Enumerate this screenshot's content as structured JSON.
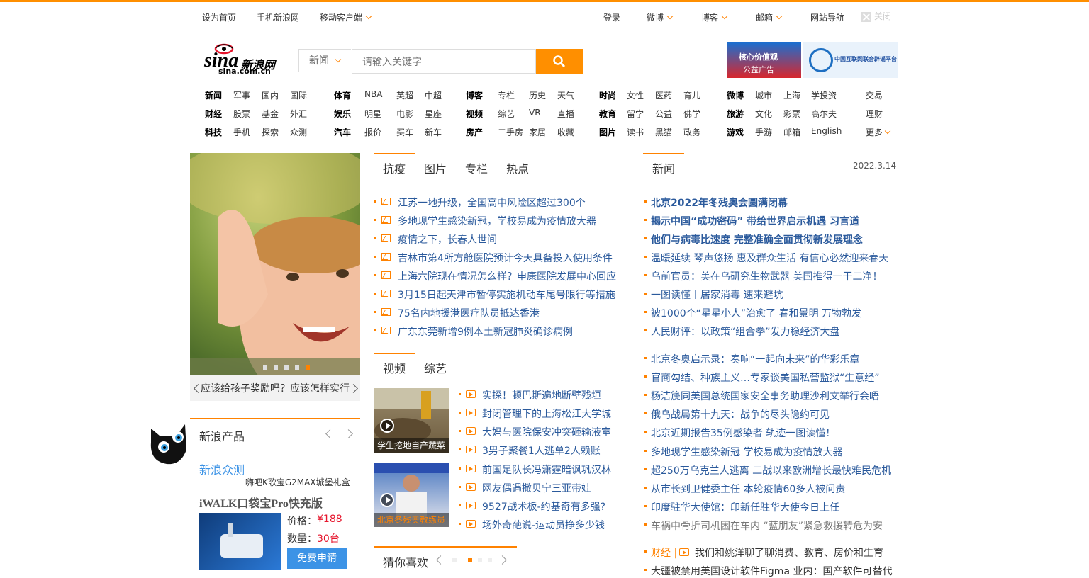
{
  "topbar": {
    "set_home": "设为首页",
    "mobile_news": "手机新浪网",
    "mobile_client": "移动客户端",
    "login": "登录",
    "weibo": "微博",
    "blog": "博客",
    "mail": "邮箱",
    "site_nav": "网站导航",
    "close": "关闭"
  },
  "logo": {
    "brand": "sina",
    "cn": "新浪网",
    "url_text": "sina.com.cn"
  },
  "search": {
    "category": "新闻",
    "placeholder": "请输入关键字"
  },
  "nav": {
    "col1": [
      [
        "新闻",
        "军事",
        "国内",
        "国际"
      ],
      [
        "财经",
        "股票",
        "基金",
        "外汇"
      ],
      [
        "科技",
        "手机",
        "探索",
        "众测"
      ]
    ],
    "col2": [
      [
        "体育",
        "NBA",
        "英超",
        "中超"
      ],
      [
        "娱乐",
        "明星",
        "电影",
        "星座"
      ],
      [
        "汽车",
        "报价",
        "买车",
        "新车"
      ]
    ],
    "col3": [
      [
        "博客",
        "专栏",
        "历史",
        "天气"
      ],
      [
        "视频",
        "综艺",
        "VR",
        "直播"
      ],
      [
        "房产",
        "二手房",
        "家居",
        "收藏"
      ]
    ],
    "col4": [
      [
        "时尚",
        "女性",
        "医药",
        "育儿"
      ],
      [
        "教育",
        "留学",
        "公益",
        "佛学"
      ],
      [
        "图片",
        "读书",
        "黑猫",
        "政务"
      ]
    ],
    "col5": [
      [
        "微博",
        "城市",
        "上海",
        "学投资"
      ],
      [
        "旅游",
        "文化",
        "彩票",
        "高尔夫"
      ],
      [
        "游戏",
        "手游",
        "邮箱",
        "English"
      ]
    ],
    "col6": [
      "交易",
      "理财",
      "更多"
    ]
  },
  "slide": {
    "caption": "应该给孩子奖励吗？应该怎样实行"
  },
  "products": {
    "title": "新浪产品",
    "subtitle": "新浪众测",
    "promo": "嗨吧K歌宝G2MAX城堡礼盒",
    "item_name": "iWALK口袋宝Pro快充版",
    "price_label": "价格：",
    "price": "¥188",
    "qty_label": "数量：",
    "qty": "30台",
    "apply": "免费申请"
  },
  "center": {
    "tabs": [
      "抗疫",
      "图片",
      "专栏",
      "热点"
    ],
    "news": [
      "江苏一地升级，全国高中风险区超过300个",
      "多地现学生感染新冠，学校易成为疫情放大器",
      "疫情之下，长春人世间",
      "吉林市第4所方舱医院预计今天具备投入使用条件",
      "上海六院现在情况怎么样？申康医院发展中心回应",
      "3月15日起天津市暂停实施机动车尾号限行等措施",
      "75名内地援港医疗队员抵达香港",
      "广东东莞新增9例本土新冠肺炎确诊病例"
    ],
    "video_tabs": [
      "视频",
      "综艺"
    ],
    "thumb1_caption": "学生挖地自产蔬菜",
    "thumb2_caption": "北京冬残奥教练员",
    "videos": [
      "实探！顿巴斯遍地断壁残垣",
      "封闭管理下的上海松江大学城",
      "大妈与医院保安冲突砸输液室",
      "3男子聚餐1人逃单2人赖账",
      "前国足队长冯潇霆暗讽巩汉林",
      "网友偶遇撒贝宁三亚带娃",
      "9527战术板-约基奇有多强?",
      "场外奇葩说-运动员挣多少钱"
    ],
    "guess": "猜你喜欢"
  },
  "right": {
    "tab": "新闻",
    "date": "2022.3.14",
    "headlines": [
      "北京2022年冬残奥会圆满闭幕",
      "揭示中国“成功密码” 带给世界启示机遇 习言道",
      "他们与病毒比速度 完整准确全面贯彻新发展理念"
    ],
    "news1": [
      "温暖延续 琴声悠扬 惠及群众生活 有信心必然迎来春天",
      "乌前官员：美在乌研究生物武器 美国推得一干二净！",
      "一图读懂丨居家消毒 速来避坑",
      "被1000个“星星小人”治愈了 春和景明 万物勃发",
      "人民财评：以政策“组合拳”发力稳经济大盘"
    ],
    "news2": [
      "北京冬奥启示录：奏响“一起向未来”的华彩乐章",
      "官商勾结、种族主义…专家谈美国私营监狱“生意经”",
      "杨洁篪同美国总统国家安全事务助理沙利文举行会晤",
      "俄乌战局第十九天：战争的尽头隐约可见",
      "北京近期报告35例感染者 轨迹一图读懂！",
      "多地现学生感染新冠 学校易成为疫情放大器",
      "超250万乌克兰人逃离 二战以来欧洲增长最快难民危机",
      "从市长到卫健委主任 本轮疫情60多人被问责",
      "印度驻华大使馆：印新任驻华大使今日上任",
      "车祸中骨折司机困在车内 “蓝朋友”紧急救援转危为安"
    ],
    "finance_label": "财经 |",
    "finance_news": "我们和姚洋聊了聊消费、教育、房价和生育",
    "last_news": "大疆被禁用美国设计软件Figma 业内：国产软件可替代"
  },
  "colors": {
    "accent": "#ff8200",
    "link_blue": "#2b5a9c",
    "button_blue": "#3c93e6"
  }
}
